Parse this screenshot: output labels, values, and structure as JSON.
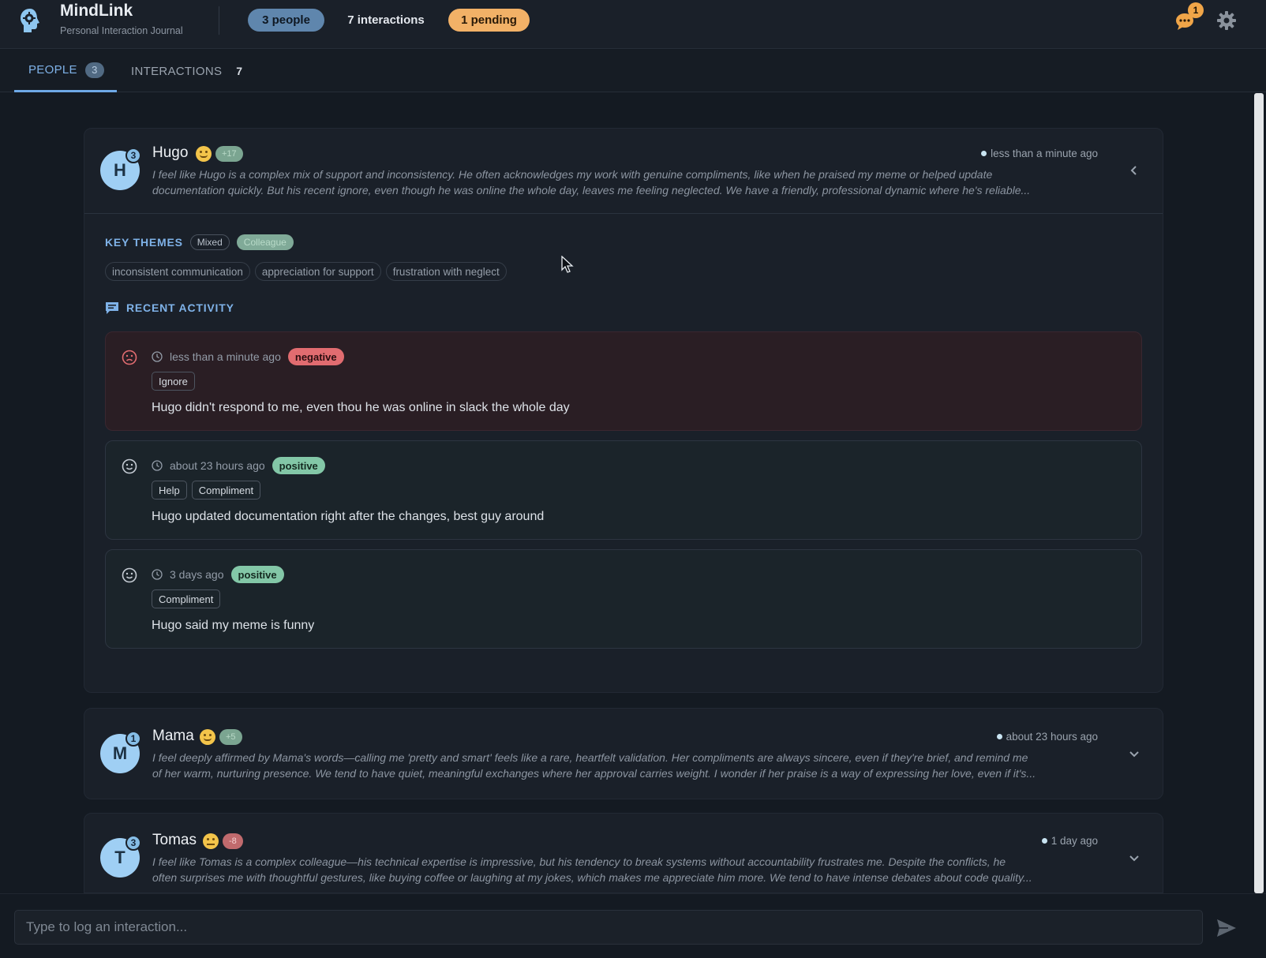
{
  "app": {
    "title": "MindLink",
    "subtitle": "Personal Interaction Journal"
  },
  "header": {
    "people_pill": "3 people",
    "interactions_pill": "7 interactions",
    "pending_pill": "1 pending",
    "notification_count": "1",
    "icons": [
      "brain-gear-icon",
      "chat-bubble-icon",
      "gear-icon"
    ]
  },
  "tabs": [
    {
      "label": "PEOPLE",
      "count": "3",
      "active": true
    },
    {
      "label": "INTERACTIONS",
      "count": "7",
      "active": false
    }
  ],
  "people": [
    {
      "initial": "H",
      "badge": "3",
      "name": "Hugo",
      "score": "+17",
      "last_time": "less than a minute ago",
      "summary_line1": "I feel like Hugo is a complex mix of support and inconsistency. He often acknowledges my work with genuine compliments, like when he praised my meme or helped update",
      "summary_line2": "documentation quickly. But his recent ignore, even though he was online the whole day, leaves me feeling neglected. We have a friendly, professional dynamic where he's reliable...",
      "expanded": true,
      "key_themes_label": "KEY THEMES",
      "tone": "Mixed",
      "relationship": "Colleague",
      "themes": [
        "inconsistent communication",
        "appreciation for support",
        "frustration with neglect"
      ],
      "recent_activity_label": "RECENT ACTIVITY",
      "activity": [
        {
          "time": "less than a minute ago",
          "sentiment": "negative",
          "tags": [
            "Ignore"
          ],
          "text": "Hugo didn't respond to me, even thou he was online in slack the whole day"
        },
        {
          "time": "about 23 hours ago",
          "sentiment": "positive",
          "tags": [
            "Help",
            "Compliment"
          ],
          "text": "Hugo updated documentation right after the changes, best guy around"
        },
        {
          "time": "3 days ago",
          "sentiment": "positive",
          "tags": [
            "Compliment"
          ],
          "text": "Hugo said my meme is funny"
        }
      ]
    },
    {
      "initial": "M",
      "badge": "1",
      "name": "Mama",
      "score": "+5",
      "last_time": "about 23 hours ago",
      "summary_line1": "I feel deeply affirmed by Mama's words—calling me 'pretty and smart' feels like a rare, heartfelt validation. Her compliments are always sincere, even if they're brief, and remind me",
      "summary_line2": "of her warm, nurturing presence. We tend to have quiet, meaningful exchanges where her approval carries weight. I wonder if her praise is a way of expressing her love, even if it's...",
      "expanded": false
    },
    {
      "initial": "T",
      "badge": "3",
      "name": "Tomas",
      "score": "-8",
      "last_time": "1 day ago",
      "summary_line1": "I feel like Tomas is a complex colleague—his technical expertise is impressive, but his tendency to break systems without accountability frustrates me. Despite the conflicts, he",
      "summary_line2": "often surprises me with thoughtful gestures, like buying coffee or laughing at my jokes, which makes me appreciate him more. We tend to have intense debates about code quality...",
      "expanded": false
    }
  ],
  "composer": {
    "placeholder": "Type to log an interaction...",
    "value": ""
  },
  "colors": {
    "background": "#141a22",
    "accent": "#7fb2e8",
    "pending": "#f2b167",
    "negative": "#e16c70",
    "positive": "#83c7a7"
  }
}
